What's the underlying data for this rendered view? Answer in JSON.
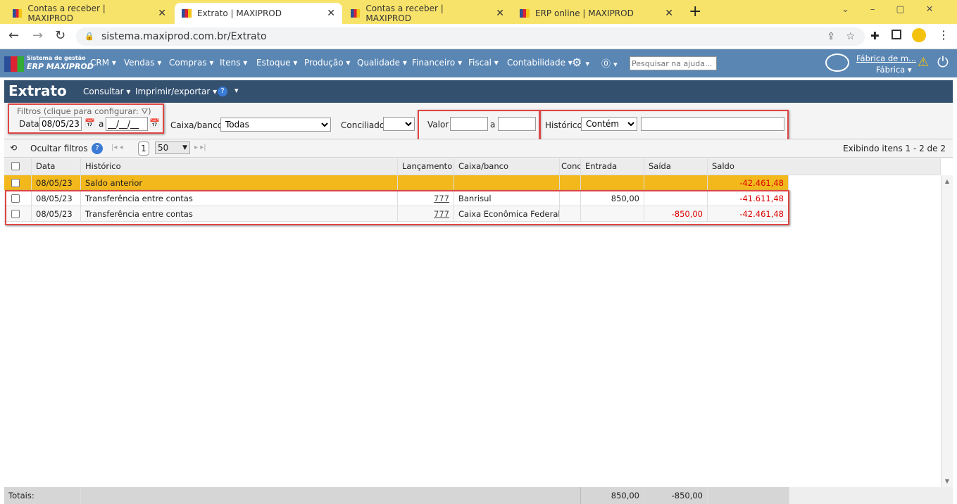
{
  "browser": {
    "tabs": [
      {
        "label": "Contas a receber | MAXIPROD"
      },
      {
        "label": "Extrato | MAXIPROD"
      },
      {
        "label": "Contas a receber | MAXIPROD"
      },
      {
        "label": "ERP online | MAXIPROD"
      }
    ],
    "url": "sistema.maxiprod.com.br/Extrato"
  },
  "app": {
    "logo_line1": "Sistema de gestão",
    "logo_line2": "ERP MAXIPROD",
    "menu": [
      "CRM",
      "Vendas",
      "Compras",
      "Itens",
      "Estoque",
      "Produção",
      "Qualidade",
      "Financeiro",
      "Fiscal",
      "Contabilidade"
    ],
    "help_search_placeholder": "Pesquisar na ajuda...",
    "company": "Fábrica de m...",
    "profile": "Fábrica"
  },
  "page": {
    "title": "Extrato",
    "consultar": "Consultar",
    "imprimir": "Imprimir/exportar"
  },
  "filters": {
    "legend": "Filtros (clique para configurar:",
    "legend_end": ")",
    "data_label": "Data",
    "data_from": "08/05/23",
    "a": "a",
    "data_to": "__/__/__",
    "caixa_label": "Caixa/banco",
    "caixa_value": "Todas",
    "conciliado_label": "Conciliado",
    "valor_label": "Valor",
    "historico_label": "Histórico",
    "historico_mode": "Contém"
  },
  "toolbar": {
    "hide_filters": "Ocultar filtros",
    "page": "1",
    "page_size": "50",
    "status": "Exibindo itens 1 - 2 de 2"
  },
  "grid": {
    "headers": [
      "Data",
      "Histórico",
      "Lançamento",
      "Caixa/banco",
      "Conc",
      "Entrada",
      "Saída",
      "Saldo"
    ],
    "rows": [
      {
        "data": "08/05/23",
        "historico": "Saldo anterior",
        "lancamento": "",
        "caixa": "",
        "entrada": "",
        "saida": "",
        "saldo": "-42.461,48"
      },
      {
        "data": "08/05/23",
        "historico": "Transferência entre contas",
        "lancamento": "777",
        "caixa": "Banrisul",
        "entrada": "850,00",
        "saida": "",
        "saldo": "-41.611,48"
      },
      {
        "data": "08/05/23",
        "historico": "Transferência entre contas",
        "lancamento": "777",
        "caixa": "Caixa Econômica Federal",
        "entrada": "",
        "saida": "-850,00",
        "saldo": "-42.461,48"
      }
    ],
    "totals_label": "Totais:",
    "total_entrada": "850,00",
    "total_saida": "-850,00"
  }
}
